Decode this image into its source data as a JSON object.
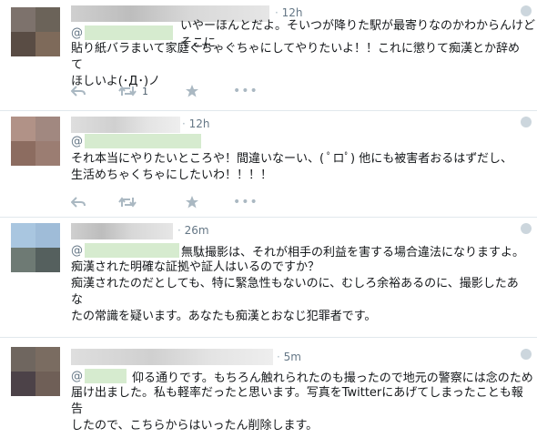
{
  "colors": {
    "page_bg": "#e6ecf0",
    "card_bg": "#ffffff",
    "mention_blur": "#d6ebcf",
    "meta_gray": "#657786",
    "icon_gray": "#aab8c2"
  },
  "tweets": [
    {
      "time": "12h",
      "mention_at": "@",
      "text_first": "いやーほんとだよ。そいつが降りた駅が最寄りなのかわからんけどそこに",
      "text_rest": "貼り紙バラまいて家庭ぐちゃぐちゃにしてやりたいよ！！これに懲りて痴漢とか辞めて\nほしいよ(･Д･)ノ",
      "retweet_count": "1"
    },
    {
      "time": "12h",
      "mention_at": "@",
      "text_first": "",
      "text_rest": "それ本当にやりたいところや！間違いなーい、( ﾟロﾟ) 他にも被害者おるはずだし、\n生活めちゃくちゃにしたいわ！！！！",
      "retweet_count": ""
    },
    {
      "time": "26m",
      "mention_at": "@",
      "text_first": "無駄撮影は、それが相手の利益を害する場合違法になりますよ。",
      "text_rest": "痴漢された明確な証拠や証人はいるのですか？\n痴漢されたのだとしても、特に緊急性もないのに、むしろ余裕あるのに、撮影したあな\nたの常識を疑います。あなたも痴漢とおなじ犯罪者です。",
      "retweet_count": ""
    },
    {
      "time": "5m",
      "mention_at": "@",
      "text_first": "仰る通りです。もちろん触れられたのも撮ったので地元の警察には念のため",
      "text_rest": "届け出ました。私も軽率だったと思います。写真をTwitterにあげてしまったことも報告\nしたので、こちらからはいったん削除します。",
      "retweet_count": ""
    }
  ],
  "icons": {
    "reply": "reply-icon",
    "retweet": "retweet-icon",
    "favorite": "star-icon",
    "more": "more-dots-icon",
    "corner": "globe-icon"
  }
}
